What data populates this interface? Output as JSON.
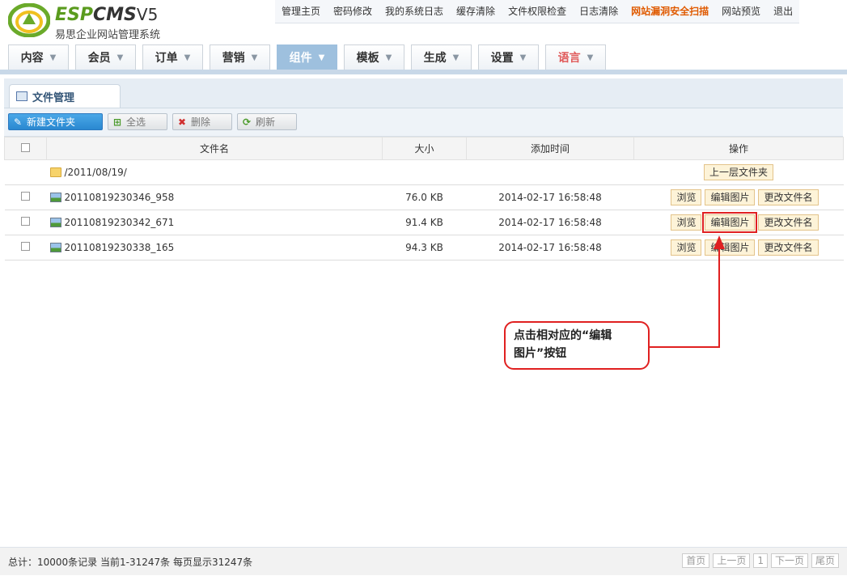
{
  "logo": {
    "brand_esp": "ESP",
    "brand_cms": "CMS",
    "version": "V5",
    "subtitle": "易思企业网站管理系统"
  },
  "top_links": [
    {
      "label": "管理主页"
    },
    {
      "label": "密码修改"
    },
    {
      "label": "我的系统日志"
    },
    {
      "label": "缓存清除"
    },
    {
      "label": "文件权限检查"
    },
    {
      "label": "日志清除"
    },
    {
      "label": "网站漏洞安全扫描"
    },
    {
      "label": "网站预览"
    },
    {
      "label": "退出"
    }
  ],
  "menu": [
    {
      "label": "内容"
    },
    {
      "label": "会员"
    },
    {
      "label": "订单"
    },
    {
      "label": "营销"
    },
    {
      "label": "组件"
    },
    {
      "label": "模板"
    },
    {
      "label": "生成"
    },
    {
      "label": "设置"
    },
    {
      "label": "语言"
    }
  ],
  "tab": {
    "label": "文件管理"
  },
  "toolbar": {
    "new_folder": "新建文件夹",
    "select_all": "全选",
    "delete": "删除",
    "refresh": "刷新"
  },
  "table": {
    "headers": {
      "name": "文件名",
      "size": "大小",
      "time": "添加时间",
      "ops": "操作"
    },
    "folder_row": {
      "name": "/2011/08/19/",
      "up_button": "上一层文件夹"
    },
    "rows": [
      {
        "name": "20110819230346_958",
        "size": "76.0 KB",
        "time": "2014-02-17 16:58:48"
      },
      {
        "name": "20110819230342_671",
        "size": "91.4 KB",
        "time": "2014-02-17 16:58:48"
      },
      {
        "name": "20110819230338_165",
        "size": "94.3 KB",
        "time": "2014-02-17 16:58:48"
      }
    ],
    "actions": {
      "browse": "浏览",
      "edit_image": "编辑图片",
      "rename": "更改文件名"
    }
  },
  "callout": {
    "line1": "点击相对应的“编辑",
    "line2": "图片”按钮"
  },
  "footer": {
    "stats": "总计：10000条记录 当前1-31247条 每页显示31247条"
  },
  "pager": {
    "first": "首页",
    "prev": "上一页",
    "current": "1",
    "next": "下一页",
    "last": "尾页"
  },
  "colors": {
    "accent_red": "#e02020",
    "active_menu": "#9ec0de",
    "alert_link": "#e05a00"
  }
}
